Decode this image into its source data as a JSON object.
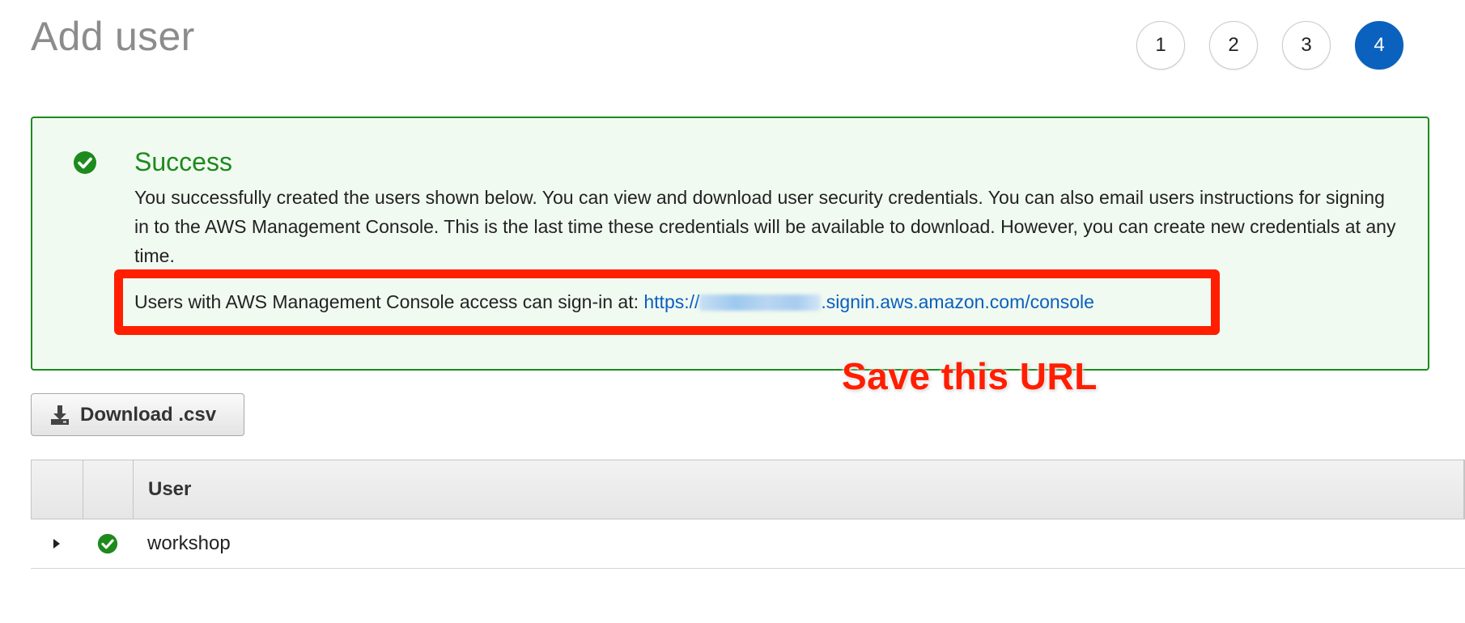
{
  "page": {
    "title": "Add user"
  },
  "steps": [
    {
      "label": "1",
      "active": false
    },
    {
      "label": "2",
      "active": false
    },
    {
      "label": "3",
      "active": false
    },
    {
      "label": "4",
      "active": true
    }
  ],
  "success": {
    "title": "Success",
    "message": "You successfully created the users shown below. You can view and download user security credentials. You can also email users instructions for signing in to the AWS Management Console. This is the last time these credentials will be available to download. However, you can create new credentials at any time.",
    "signin_prefix": "Users with AWS Management Console access can sign-in at:",
    "url_start": "https://",
    "url_end": ".signin.aws.amazon.com/console",
    "icon": "check-circle-icon"
  },
  "annotation": {
    "text": "Save this URL"
  },
  "toolbar": {
    "download_label": "Download .csv",
    "download_icon": "download-icon"
  },
  "table": {
    "columns": [
      "",
      "",
      "User"
    ],
    "rows": [
      {
        "user": "workshop",
        "status_icon": "check-circle-icon",
        "expand_icon": "caret-right-icon"
      }
    ]
  },
  "colors": {
    "success_green": "#1d8a1d",
    "link_blue": "#0a5fbf",
    "active_step": "#0b61be",
    "annotation_red": "#ff1e00"
  }
}
